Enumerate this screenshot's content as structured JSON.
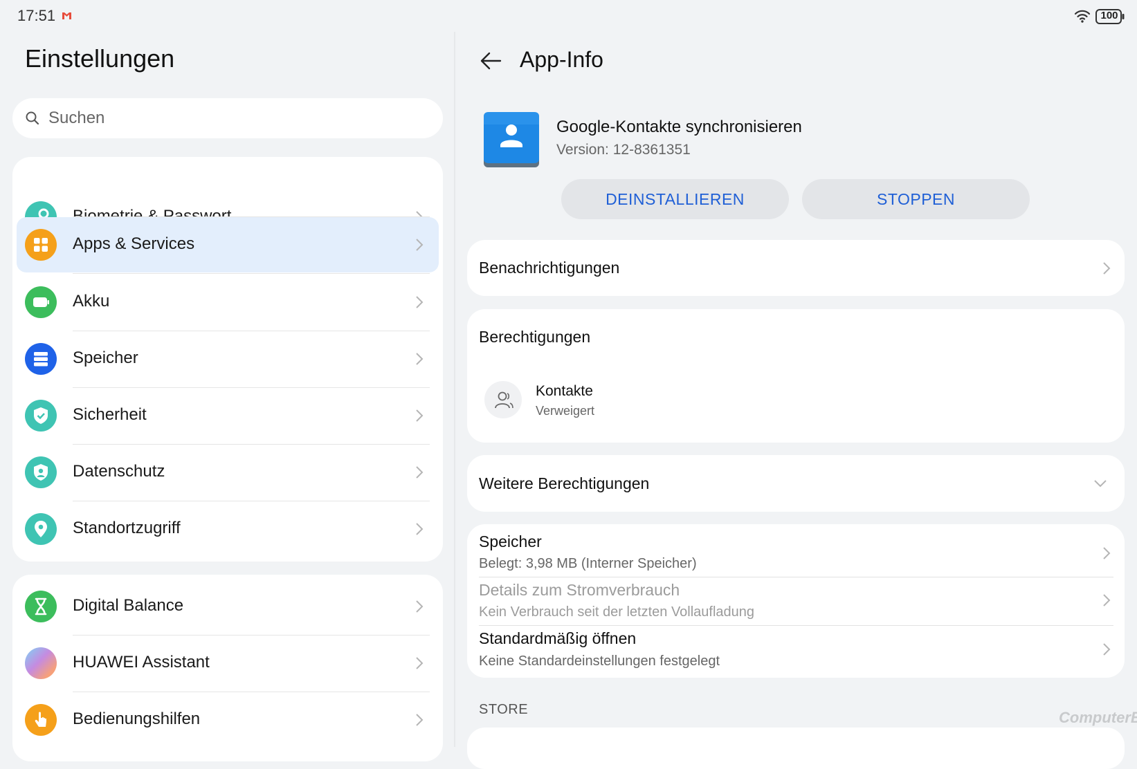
{
  "status_bar": {
    "time": "17:51",
    "battery": "100"
  },
  "left": {
    "title": "Einstellungen",
    "search": {
      "placeholder": "Suchen"
    },
    "group1": [
      {
        "label": "Biometrie & Passwort",
        "icon": "key-icon",
        "color": "#3fc4b3"
      },
      {
        "label": "Apps & Services",
        "icon": "apps-icon",
        "color": "#f5a01a",
        "selected": true
      },
      {
        "label": "Akku",
        "icon": "battery-icon",
        "color": "#3cbd5c"
      },
      {
        "label": "Speicher",
        "icon": "storage-icon",
        "color": "#1f62e8"
      },
      {
        "label": "Sicherheit",
        "icon": "shield-icon",
        "color": "#3fc4b3"
      },
      {
        "label": "Datenschutz",
        "icon": "privacy-icon",
        "color": "#3fc4b3"
      },
      {
        "label": "Standortzugriff",
        "icon": "location-icon",
        "color": "#3fc4b3"
      }
    ],
    "group2": [
      {
        "label": "Digital Balance",
        "icon": "hourglass-icon",
        "color": "#3cbd5c"
      },
      {
        "label": "HUAWEI Assistant",
        "icon": "assistant-icon",
        "color": "#c58be0"
      },
      {
        "label": "Bedienungshilfen",
        "icon": "hand-icon",
        "color": "#f5a01a"
      }
    ]
  },
  "right": {
    "title": "App-Info",
    "app": {
      "name": "Google-Kontakte synchronisieren",
      "version": "Version: 12-8361351"
    },
    "buttons": {
      "uninstall": "DEINSTALLIEREN",
      "stop": "STOPPEN"
    },
    "notifications": "Benachrichtigungen",
    "permissions": {
      "title": "Berechtigungen",
      "item": {
        "label": "Kontakte",
        "status": "Verweigert"
      }
    },
    "more_permissions": "Weitere Berechtigungen",
    "storage": {
      "label": "Speicher",
      "sub": "Belegt: 3,98 MB (Interner Speicher)"
    },
    "power": {
      "label": "Details zum Stromverbrauch",
      "sub": "Kein Verbrauch seit der letzten Vollaufladung"
    },
    "default_open": {
      "label": "Standardmäßig öffnen",
      "sub": "Keine Standardeinstellungen festgelegt"
    },
    "store_section": "STORE"
  },
  "watermark": "ComputerBase"
}
